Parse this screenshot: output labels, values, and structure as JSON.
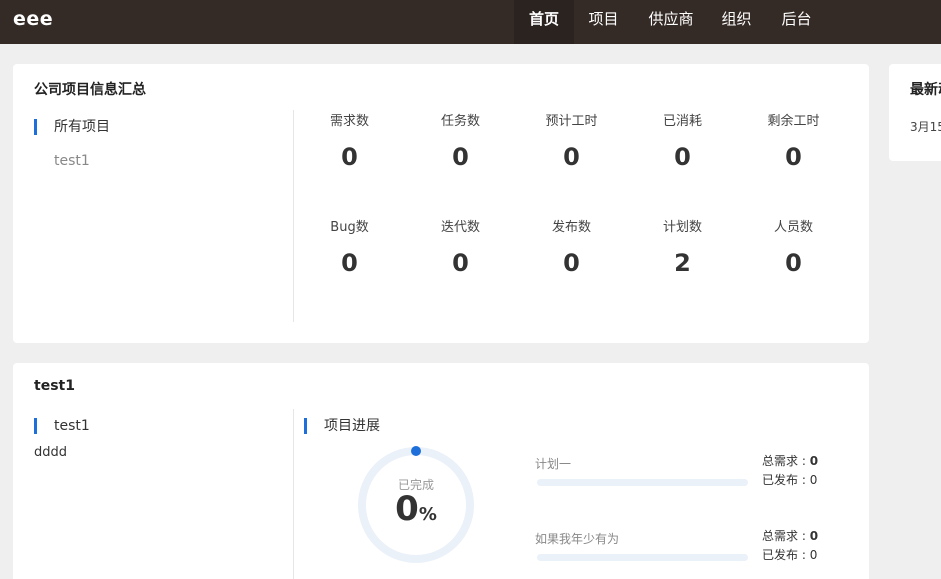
{
  "brand": "eee",
  "nav": {
    "items": [
      {
        "label": "首页",
        "active": true
      },
      {
        "label": "项目",
        "active": false
      },
      {
        "label": "供应商",
        "active": false
      },
      {
        "label": "组织",
        "active": false
      },
      {
        "label": "后台",
        "active": false
      }
    ]
  },
  "summary": {
    "title": "公司项目信息汇总",
    "side_heading": "所有项目",
    "side_items": [
      "test1"
    ],
    "stats": [
      {
        "label": "需求数",
        "value": "0"
      },
      {
        "label": "任务数",
        "value": "0"
      },
      {
        "label": "预计工时",
        "value": "0"
      },
      {
        "label": "已消耗",
        "value": "0"
      },
      {
        "label": "剩余工时",
        "value": "0"
      },
      {
        "label": "Bug数",
        "value": "0"
      },
      {
        "label": "迭代数",
        "value": "0"
      },
      {
        "label": "发布数",
        "value": "0"
      },
      {
        "label": "计划数",
        "value": "2"
      },
      {
        "label": "人员数",
        "value": "0"
      }
    ]
  },
  "latest": {
    "title": "最新动",
    "date": "3月15"
  },
  "project": {
    "title": "test1",
    "side_heading": "test1",
    "description": "dddd",
    "progress_heading": "项目进展",
    "ring": {
      "label": "已完成",
      "value": "0",
      "unit": "%",
      "percent": 0
    },
    "plans": [
      {
        "name": "计划一",
        "req_label": "总需求 : ",
        "req_value": "0",
        "release_label": "已发布 : ",
        "release_value": "0",
        "progress": 0
      },
      {
        "name": "如果我年少有为",
        "req_label": "总需求 : ",
        "req_value": "0",
        "release_label": "已发布 : ",
        "release_value": "0",
        "progress": 0
      }
    ]
  },
  "colors": {
    "topbar": "#342b26",
    "accent": "#1e6fd9",
    "ring_track": "#ebf1f9"
  }
}
